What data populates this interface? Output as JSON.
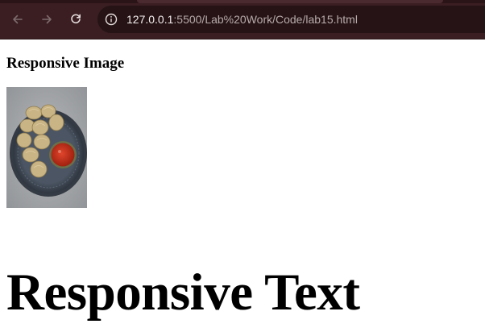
{
  "browser": {
    "url_host": "127.0.0.1",
    "url_rest": ":5500/Lab%20Work/Code/lab15.html",
    "icons": [
      "back-arrow-icon",
      "forward-arrow-icon",
      "reload-icon",
      "site-info-icon"
    ],
    "colors": {
      "toolbar": "#3a1e22",
      "address_bar": "#251315"
    }
  },
  "page": {
    "heading": "Responsive Image",
    "image_subject": "plate of dumplings with red dipping sauce",
    "big_text": "Responsive Text"
  }
}
